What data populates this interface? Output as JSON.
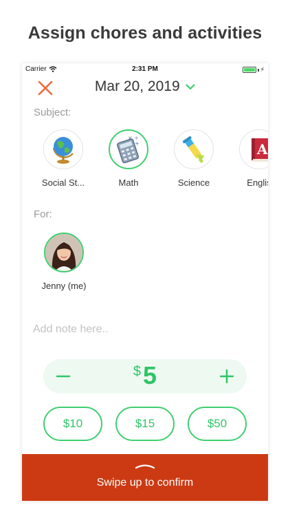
{
  "headline": "Assign chores and activities",
  "status_bar": {
    "carrier": "Carrier",
    "time": "2:31 PM",
    "battery": 1.0
  },
  "header": {
    "close_icon": "close-x-icon",
    "date": "Mar 20, 2019",
    "dropdown_icon": "chevron-down-icon"
  },
  "subject_section": {
    "label": "Subject:",
    "items": [
      {
        "label": "Social St...",
        "icon": "globe-icon",
        "selected": false
      },
      {
        "label": "Math",
        "icon": "calculator-icon",
        "selected": true
      },
      {
        "label": "Science",
        "icon": "test-tube-icon",
        "selected": false
      },
      {
        "label": "Englis",
        "icon": "book-icon",
        "selected": false
      }
    ]
  },
  "for_section": {
    "label": "For:",
    "person": {
      "name": "Jenny (me)",
      "selected": true
    }
  },
  "note": {
    "placeholder": "Add note here.."
  },
  "amount": {
    "currency": "$",
    "value": "5",
    "minus_icon": "minus-icon",
    "plus_icon": "plus-icon",
    "presets": [
      "$10",
      "$15",
      "$50"
    ]
  },
  "confirm": {
    "label": "Swipe up to confirm",
    "icon": "swipe-up-handle-icon"
  },
  "colors": {
    "accent_green": "#3ecf6e",
    "confirm_bar": "#cc3a13",
    "close_icon": "#f06a3c",
    "stepper_bg": "#eef9f1"
  }
}
